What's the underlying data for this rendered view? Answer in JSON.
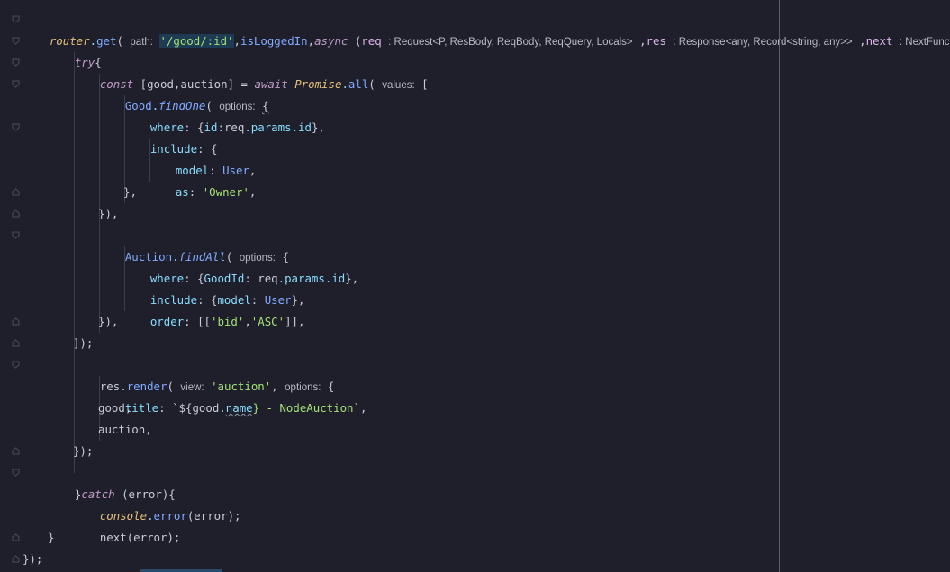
{
  "code": {
    "l1": {
      "router": "router",
      "dot": ".",
      "get": "get",
      "open": "(",
      "hint_path": "path:",
      "path": "'/good/:id'",
      "comma1": ",",
      "isLoggedIn": "isLoggedIn",
      "comma2": ",",
      "async": "async",
      "paren": " (",
      "req": "req",
      "hint_req": ": Request<P, ResBody, ReqBody, ReqQuery, Locals>",
      "comma3": " ,",
      "res": "res",
      "hint_res": ": Response<any, Record<string, any>>",
      "comma4": " ,",
      "next": "next",
      "hint_next": ": NextFunction",
      "arrow": " )⇒{"
    },
    "l2": {
      "try": "try",
      "brace": "{"
    },
    "l3": {
      "const": "const",
      "destructure": " [good,auction] = ",
      "await": "await",
      "promise": "Promise",
      "dot": ".",
      "all": "all",
      "open": "(",
      "hint_values": "values:",
      "bracket": "["
    },
    "l4": {
      "good": "Good",
      "dot": ".",
      "findOne": "findOne",
      "open": "(",
      "hint_options": "options:",
      "brace": "{"
    },
    "l5": {
      "where": "where",
      "rest": ": {id:req.params.id},",
      "req": "req",
      "params": "params",
      "id": "id"
    },
    "l6": {
      "include": "include",
      "rest": ": {"
    },
    "l7": {
      "model": "model",
      "colon": ": ",
      "user": "User",
      "comma": ","
    },
    "l8": {
      "as": "as",
      "colon": ": ",
      "owner": "'Owner'",
      "comma": ","
    },
    "l9": {
      "text": "},"
    },
    "l10": {
      "text": "}),"
    },
    "l11": {
      "auction": "Auction",
      "dot": ".",
      "findAll": "findAll",
      "open": "(",
      "hint_options": "options:",
      "brace": "{"
    },
    "l12": {
      "where": "where",
      "colon": ": {",
      "goodId": "GoodId",
      "colon2": ": ",
      "req": "req",
      "params": "params",
      "id": "id",
      "close": "},"
    },
    "l13": {
      "include": "include",
      "colon": ": {",
      "model": "model",
      "colon2": ": ",
      "user": "User",
      "close": "},"
    },
    "l14": {
      "order": "order",
      "colon": ": [[",
      "bid": "'bid'",
      "comma": ",",
      "asc": "'ASC'",
      "close": "]],"
    },
    "l15": {
      "text": "}),"
    },
    "l16": {
      "text": "]);"
    },
    "l17": {
      "res": "res",
      "dot": ".",
      "render": "render",
      "open": "(",
      "hint_view": "view:",
      "view": "'auction'",
      "comma": ",",
      "hint_options": "options:",
      "brace": "{"
    },
    "l18": {
      "title": "title",
      "colon": ": ",
      "tpl_open": "`${",
      "good": "good",
      "dot": ".",
      "name": "name",
      "tpl_rest": "} - NodeAuction`",
      "comma": ","
    },
    "l19": {
      "text": "good,"
    },
    "l20": {
      "text": "auction,"
    },
    "l21": {
      "text": "});"
    },
    "l22": {
      "close": "}",
      "catch": "catch",
      "rest": " (error){"
    },
    "l23": {
      "console": "console",
      "dot": ".",
      "error": "error",
      "rest": "(error);"
    },
    "l24": {
      "next": "next",
      "rest": "(error);"
    },
    "l25": {
      "text": "}"
    },
    "l26": {
      "text": "});"
    }
  },
  "colors": {
    "background": "#1e1f2b",
    "keyword": "#c39ac9",
    "function": "#82aaff",
    "string": "#a5e075",
    "property": "#89ddff",
    "class": "#e5c07b"
  }
}
